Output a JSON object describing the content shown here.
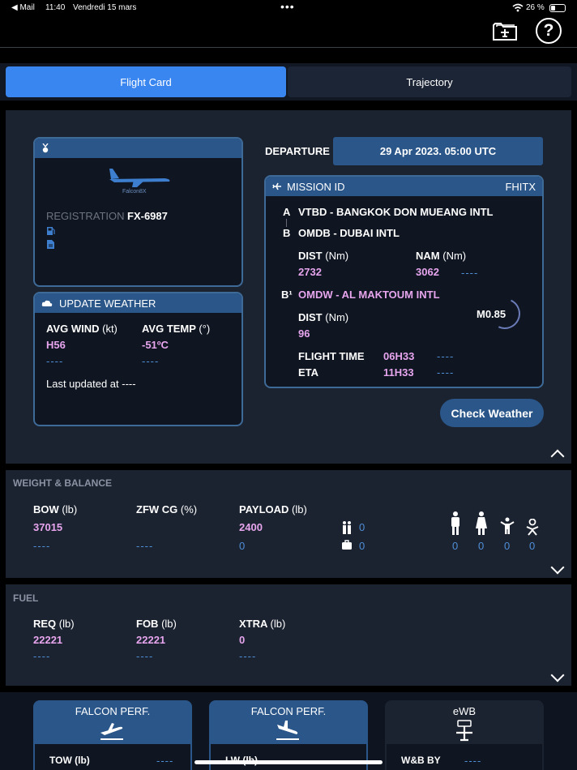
{
  "status_bar": {
    "back_app": "◀ Mail",
    "time": "11:40",
    "date": "Vendredi 15 mars",
    "battery": "26 %"
  },
  "tabs": {
    "flight_card": "Flight Card",
    "trajectory": "Trajectory"
  },
  "aircraft": {
    "model_logo": "Falcon8X",
    "registration_label": "REGISTRATION",
    "registration": "FX-6987"
  },
  "departure": {
    "label": "DEPARTURE",
    "value": "29 Apr 2023. 05:00 UTC"
  },
  "mission": {
    "title": "MISSION ID",
    "id": "FHITX",
    "a_letter": "A",
    "a_airport": "VTBD - BANGKOK DON MUEANG INTL",
    "b_letter": "B",
    "b_airport": "OMDB - DUBAI INTL",
    "dist_label": "DIST",
    "dist_unit": "(Nm)",
    "dist": "2732",
    "nam_label": "NAM",
    "nam_unit": "(Nm)",
    "nam": "3062",
    "nam_dash": "----",
    "b1_letter": "B¹",
    "b1_airport": "OMDW - AL MAKTOUM INTL",
    "alt_dist_label": "DIST",
    "alt_dist_unit": "(Nm)",
    "alt_dist": "96",
    "mach": "M0.85",
    "flight_time_label": "FLIGHT TIME",
    "flight_time": "06H33",
    "flight_time_dash": "----",
    "eta_label": "ETA",
    "eta": "11H33",
    "eta_dash": "----"
  },
  "weather": {
    "title": "UPDATE WEATHER",
    "wind_label": "AVG WIND",
    "wind_unit": "(kt)",
    "wind": "H56",
    "wind_dash": "----",
    "temp_label": "AVG TEMP",
    "temp_unit": "(°)",
    "temp": "-51ºC",
    "temp_dash": "----",
    "last_updated": "Last updated at ----",
    "check_button": "Check Weather"
  },
  "weight_balance": {
    "title": "WEIGHT & BALANCE",
    "bow_label": "BOW",
    "bow_unit": "(lb)",
    "bow": "37015",
    "bow_dash": "----",
    "zfw_label": "ZFW CG",
    "zfw_unit": "(%)",
    "zfw_dash": "----",
    "payload_label": "PAYLOAD",
    "payload_unit": "(lb)",
    "payload": "2400",
    "payload_second": "0",
    "pax_count": "0",
    "bag_count": "0",
    "man": "0",
    "woman": "0",
    "child": "0",
    "infant": "0"
  },
  "fuel": {
    "title": "FUEL",
    "req_label": "REQ",
    "req_unit": "(lb)",
    "req": "22221",
    "req_dash": "----",
    "fob_label": "FOB",
    "fob_unit": "(lb)",
    "fob": "22221",
    "fob_dash": "----",
    "xtra_label": "XTRA",
    "xtra_unit": "(lb)",
    "xtra": "0",
    "xtra_dash": "----"
  },
  "bottom_cards": {
    "takeoff_title": "FALCON PERF.",
    "takeoff_row_label": "TOW (lb)",
    "takeoff_dash": "----",
    "landing_title": "FALCON PERF.",
    "landing_row_label": "LW (lb)",
    "landing_dash": "----",
    "ewb_title": "eWB",
    "ewb_row_label": "W&B BY",
    "ewb_dash": "----"
  }
}
